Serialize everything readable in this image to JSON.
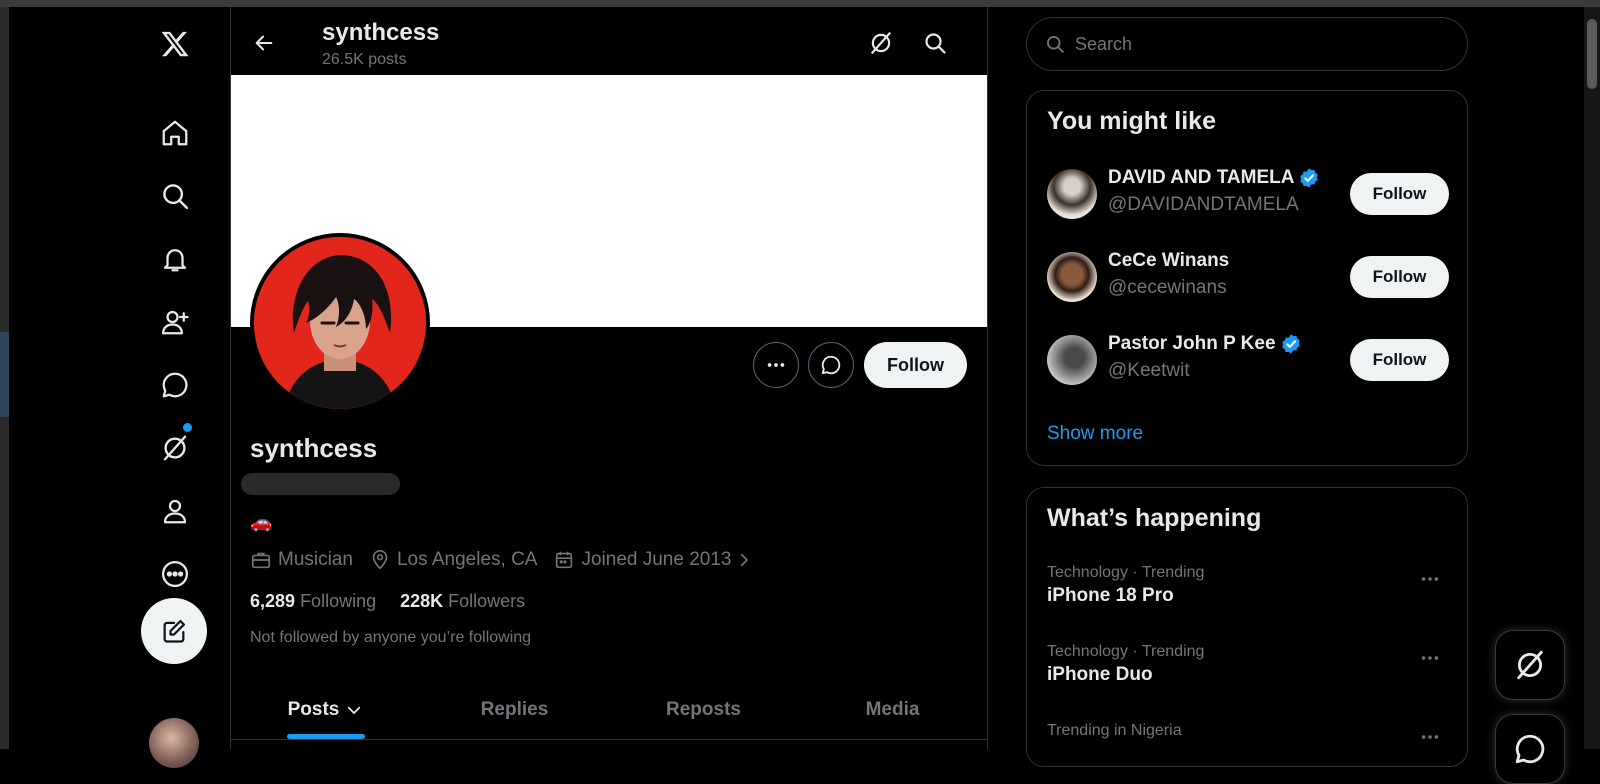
{
  "header": {
    "title": "synthcess",
    "posts_count": "26.5K posts"
  },
  "profile": {
    "display_name": "synthcess",
    "bio_emoji": "🚗",
    "meta": {
      "category": "Musician",
      "location": "Los Angeles, CA",
      "joined": "Joined June 2013"
    },
    "stats": {
      "following_count": "6,289",
      "following_label": "Following",
      "followers_count": "228K",
      "followers_label": "Followers"
    },
    "not_followed_text": "Not followed by anyone you’re following",
    "follow_label": "Follow"
  },
  "tabs": [
    {
      "label": "Posts",
      "active": true
    },
    {
      "label": "Replies"
    },
    {
      "label": "Reposts"
    },
    {
      "label": "Media"
    }
  ],
  "search": {
    "placeholder": "Search"
  },
  "you_might_like": {
    "title": "You might like",
    "items": [
      {
        "name": "DAVID AND TAMELA",
        "handle": "@DAVIDANDTAMELA",
        "verified": true,
        "button": "Follow"
      },
      {
        "name": "CeCe Winans",
        "handle": "@cecewinans",
        "verified": false,
        "button": "Follow"
      },
      {
        "name": "Pastor John P Kee",
        "handle": "@Keetwit",
        "verified": true,
        "button": "Follow"
      }
    ],
    "show_more": "Show more"
  },
  "whats_happening": {
    "title": "What’s happening",
    "trends": [
      {
        "context": "Technology · Trending",
        "title": "iPhone 18 Pro"
      },
      {
        "context": "Technology · Trending",
        "title": "iPhone Duo"
      },
      {
        "context": "Trending in Nigeria",
        "title": ""
      }
    ]
  },
  "colors": {
    "accent": "#1d9bf0",
    "background": "#000000",
    "muted": "#71767b",
    "text": "#e7e9ea",
    "border": "#2f3336"
  },
  "icons": [
    "x-logo-icon",
    "home-icon",
    "search-icon",
    "notifications-icon",
    "follow-icon",
    "messages-icon",
    "grok-icon",
    "profile-icon",
    "more-icon",
    "compose-icon",
    "back-arrow-icon",
    "briefcase-icon",
    "location-icon",
    "calendar-icon",
    "verified-badge-icon",
    "chevron-down-icon"
  ]
}
